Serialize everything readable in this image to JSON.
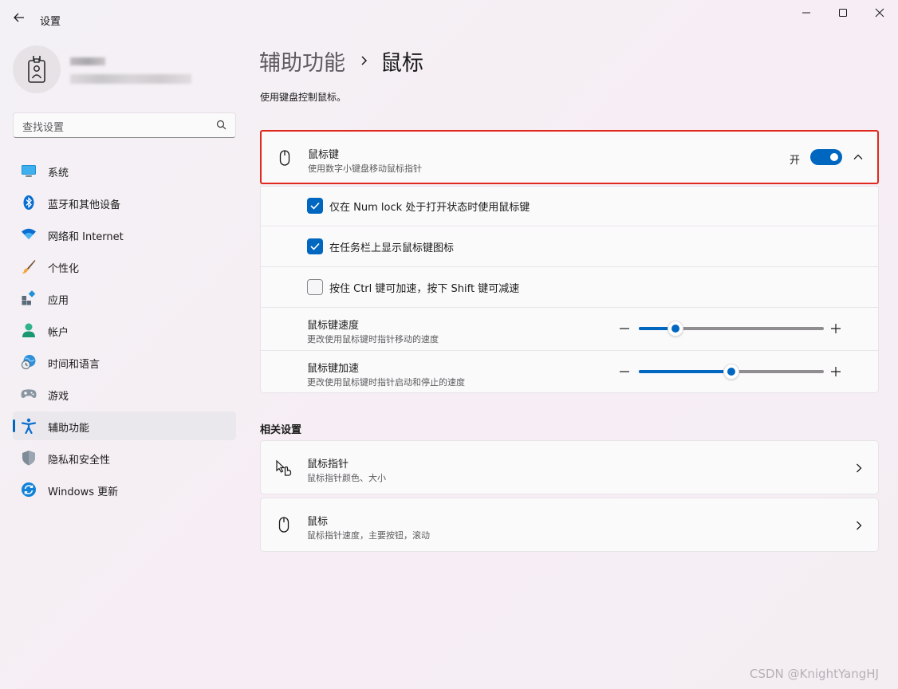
{
  "window": {
    "title": "设置",
    "controls": [
      "minimize",
      "maximize",
      "close"
    ]
  },
  "user": {
    "avatar_icon": "id-badge-icon"
  },
  "search": {
    "placeholder": "查找设置",
    "icon": "search-icon"
  },
  "sidebar": {
    "items": [
      {
        "label": "系统",
        "icon": "display-icon",
        "active": false
      },
      {
        "label": "蓝牙和其他设备",
        "icon": "bluetooth-icon",
        "active": false
      },
      {
        "label": "网络和 Internet",
        "icon": "wifi-icon",
        "active": false
      },
      {
        "label": "个性化",
        "icon": "brush-icon",
        "active": false
      },
      {
        "label": "应用",
        "icon": "apps-icon",
        "active": false
      },
      {
        "label": "帐户",
        "icon": "person-icon",
        "active": false
      },
      {
        "label": "时间和语言",
        "icon": "globe-clock-icon",
        "active": false
      },
      {
        "label": "游戏",
        "icon": "gamepad-icon",
        "active": false
      },
      {
        "label": "辅助功能",
        "icon": "accessibility-icon",
        "active": true
      },
      {
        "label": "隐私和安全性",
        "icon": "shield-icon",
        "active": false
      },
      {
        "label": "Windows 更新",
        "icon": "update-icon",
        "active": false
      }
    ]
  },
  "header": {
    "breadcrumb_parent": "辅助功能",
    "breadcrumb_current": "鼠标",
    "description": "使用键盘控制鼠标。"
  },
  "mouse_keys": {
    "title": "鼠标键",
    "subtitle": "使用数字小键盘移动鼠标指针",
    "toggle_label": "开",
    "enabled": true,
    "expanded": true,
    "options": [
      {
        "label": "仅在 Num lock 处于打开状态时使用鼠标键",
        "checked": true
      },
      {
        "label": "在任务栏上显示鼠标键图标",
        "checked": true
      },
      {
        "label": "按住 Ctrl 键可加速，按下 Shift 键可减速",
        "checked": false
      }
    ],
    "speed": {
      "title": "鼠标键速度",
      "subtitle": "更改使用鼠标键时指针移动的速度",
      "value_fraction": 0.2
    },
    "acceleration": {
      "title": "鼠标键加速",
      "subtitle": "更改使用鼠标键时指针启动和停止的速度",
      "value_fraction": 0.5
    }
  },
  "related": {
    "title": "相关设置",
    "items": [
      {
        "title": "鼠标指针",
        "subtitle": "鼠标指针颜色、大小",
        "icon": "mouse-pointer-icon"
      },
      {
        "title": "鼠标",
        "subtitle": "鼠标指针速度，主要按钮，滚动",
        "icon": "mouse-icon"
      }
    ]
  },
  "watermark": "CSDN @KnightYangHJ",
  "colors": {
    "accent": "#0067c0",
    "highlight_border": "#e0281e"
  }
}
